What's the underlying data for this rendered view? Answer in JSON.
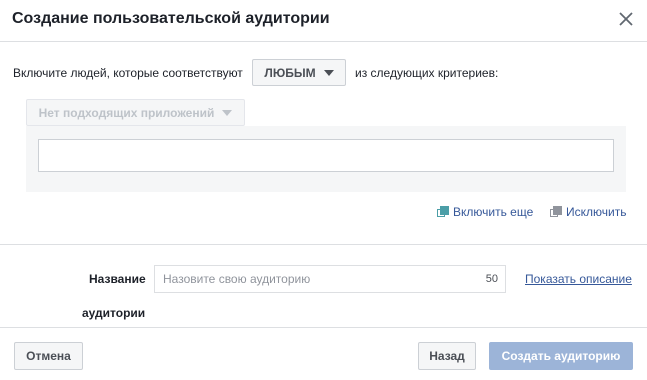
{
  "dialog": {
    "title": "Создание пользовательской аудитории"
  },
  "rule": {
    "prefix": "Включите людей, которые соответствуют",
    "match_value": "ЛЮБЫМ",
    "suffix": "из следующих критериев:",
    "apps_dropdown": "Нет подходящих приложений",
    "criteria_value": ""
  },
  "actions": {
    "include_more": "Включить еще",
    "exclude": "Исключить"
  },
  "audience_name": {
    "label_line1": "Название",
    "label_line2": "аудитории",
    "placeholder": "Назовите свою аудиторию",
    "counter": "50",
    "show_description": "Показать описание"
  },
  "footer": {
    "cancel": "Отмена",
    "back": "Назад",
    "create": "Создать аудиторию"
  },
  "colors": {
    "link": "#365899",
    "primary_disabled": "#9cb4d8",
    "panel_bg": "#f5f6f7"
  }
}
